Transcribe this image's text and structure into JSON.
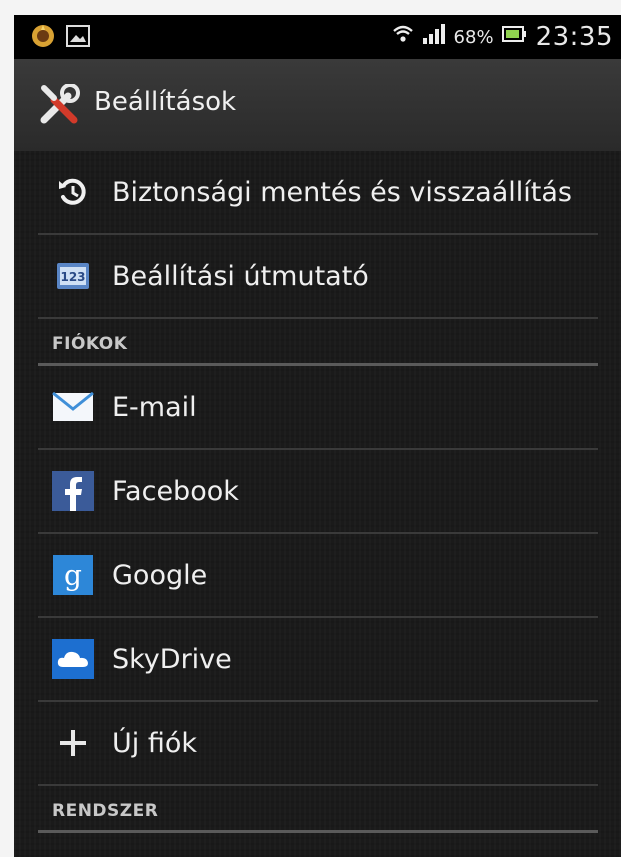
{
  "status_bar": {
    "battery_percent": "68%",
    "time": "23:35",
    "icons": [
      "notification-app-icon",
      "notification-image-icon",
      "wifi-icon",
      "signal-icon",
      "battery-icon"
    ]
  },
  "action_bar": {
    "title": "Beállítások",
    "icon": "tools-icon"
  },
  "top_items": [
    {
      "label": "Biztonsági mentés és visszaállítás",
      "icon": "backup-restore-icon"
    },
    {
      "label": "Beállítási útmutató",
      "icon": "setup-guide-icon"
    }
  ],
  "sections": {
    "accounts": "FIÓKOK",
    "system": "RENDSZER"
  },
  "accounts": [
    {
      "label": "E-mail",
      "icon": "email-icon"
    },
    {
      "label": "Facebook",
      "icon": "facebook-icon"
    },
    {
      "label": "Google",
      "icon": "google-icon"
    },
    {
      "label": "SkyDrive",
      "icon": "skydrive-icon"
    },
    {
      "label": "Új fiók",
      "icon": "plus-icon"
    }
  ],
  "colors": {
    "background": "#1a1a1a",
    "action_bar": "#333333",
    "facebook": "#3b5b99",
    "google": "#2d87d8",
    "skydrive": "#1d6fd0"
  }
}
